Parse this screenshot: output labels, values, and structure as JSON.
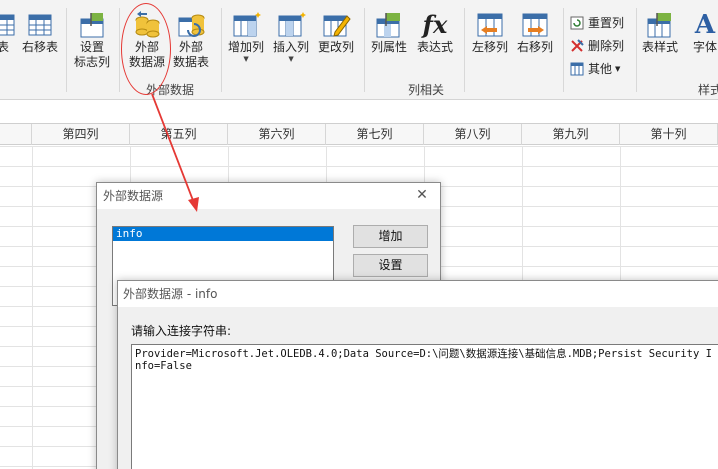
{
  "ribbon": {
    "buttons": [
      {
        "label": "表",
        "icon": "table-icon"
      },
      {
        "label": "右移表",
        "icon": "move-table-right-icon"
      },
      {
        "label": "设置\n标志列",
        "icon": "set-flag-column-icon"
      },
      {
        "label": "外部\n数据源",
        "icon": "external-datasource-icon"
      },
      {
        "label": "外部\n数据表",
        "icon": "external-datatable-icon"
      },
      {
        "label": "增加列",
        "icon": "add-column-icon"
      },
      {
        "label": "插入列",
        "icon": "insert-column-icon"
      },
      {
        "label": "更改列",
        "icon": "edit-column-icon"
      },
      {
        "label": "列属性",
        "icon": "column-properties-icon"
      },
      {
        "label": "表达式",
        "icon": "fx-icon",
        "glyph": "fx"
      },
      {
        "label": "左移列",
        "icon": "move-column-left-icon"
      },
      {
        "label": "右移列",
        "icon": "move-column-right-icon"
      },
      {
        "label": "表样式",
        "icon": "table-style-icon"
      },
      {
        "label": "字体",
        "icon": "font-icon",
        "glyph": "A"
      }
    ],
    "small_buttons": [
      {
        "label": "重置列",
        "icon": "reset-column-icon"
      },
      {
        "label": "删除列",
        "icon": "delete-column-icon"
      },
      {
        "label": "其他",
        "icon": "other-icon"
      }
    ],
    "groups": [
      "外部数据",
      "列相关",
      "样式"
    ]
  },
  "grid": {
    "columns": [
      "第四列",
      "第五列",
      "第六列",
      "第七列",
      "第八列",
      "第九列",
      "第十列"
    ]
  },
  "dialog_datasource": {
    "title": "外部数据源",
    "list_items": [
      "info"
    ],
    "add_label": "增加",
    "settings_label": "设置"
  },
  "dialog_connection": {
    "title": "外部数据源 - info",
    "prompt": "请输入连接字符串:",
    "connection_string": "Provider=Microsoft.Jet.OLEDB.4.0;Data Source=D:\\问题\\数据源连接\\基础信息.MDB;Persist Security Info=False"
  },
  "colors": {
    "annotation": "#e53935",
    "selection": "#0078d7"
  }
}
